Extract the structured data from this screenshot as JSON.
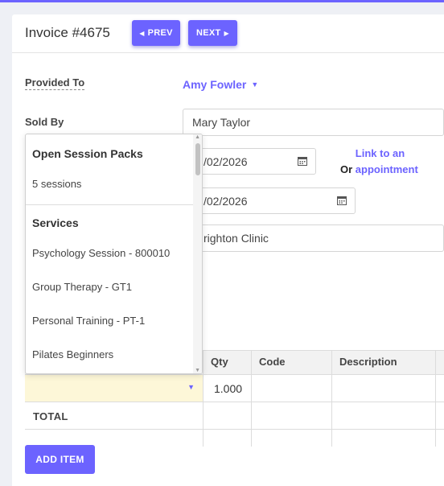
{
  "header": {
    "title": "Invoice #4675",
    "prev_label": "PREV",
    "next_label": "NEXT"
  },
  "form": {
    "provided_to_label": "Provided To",
    "provided_to_value": "Amy Fowler",
    "sold_by_label": "Sold By",
    "sold_by_value": "Mary Taylor",
    "date1_value": "/02/2026",
    "date2_value": "/02/2026",
    "or_text": "Or",
    "link_appointment": "Link to an appointment",
    "location_value": "righton Clinic"
  },
  "table": {
    "headers": [
      "Qty",
      "Code",
      "Description"
    ],
    "row_qty": "1.000",
    "total_label": "TOTAL"
  },
  "add_item_label": "ADD ITEM",
  "dropdown": {
    "group1": "Open Session Packs",
    "group1_items": [
      "5 sessions"
    ],
    "group2": "Services",
    "group2_items": [
      "Psychology Session - 800010",
      "Group Therapy - GT1",
      "Personal Training - PT-1",
      "Pilates Beginners"
    ]
  },
  "colors": {
    "accent": "#6c63ff",
    "highlight": "#fdf7d8"
  }
}
